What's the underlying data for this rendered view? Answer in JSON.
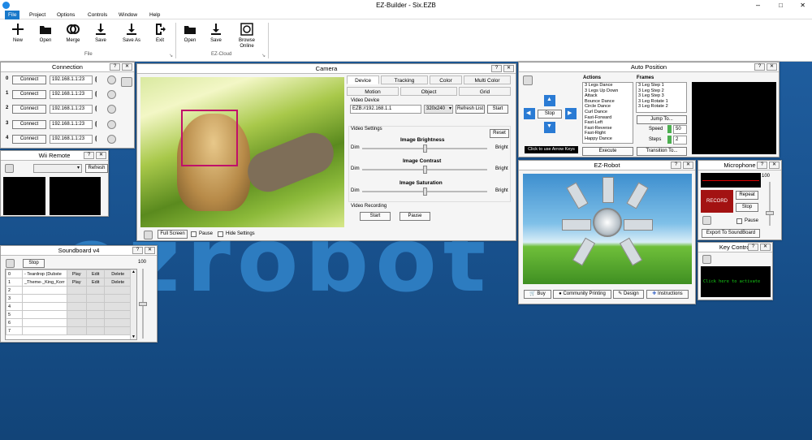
{
  "app": {
    "title": "EZ-Builder - Six.EZB"
  },
  "menu": [
    "File",
    "Project",
    "Options",
    "Controls",
    "Window",
    "Help"
  ],
  "ribbon": {
    "file_buttons": [
      {
        "label": "New",
        "icon": "new-icon"
      },
      {
        "label": "Open",
        "icon": "open-folder-icon"
      },
      {
        "label": "Merge",
        "icon": "merge-icon"
      },
      {
        "label": "Save",
        "icon": "save-icon"
      },
      {
        "label": "Save As",
        "icon": "save-as-icon"
      },
      {
        "label": "Exit",
        "icon": "exit-icon"
      }
    ],
    "file_group": "File",
    "cloud_buttons": [
      {
        "label": "Open",
        "icon": "open-folder-icon"
      },
      {
        "label": "Save",
        "icon": "save-icon"
      },
      {
        "label": "Browse Online",
        "icon": "browse-online-icon"
      }
    ],
    "cloud_group": "EZ-Cloud"
  },
  "background": {
    "logo_text": "ezrobot"
  },
  "connection": {
    "title": "Connection",
    "rows": [
      {
        "index": "0",
        "button": "Connect",
        "address": "192.168.1.1:23"
      },
      {
        "index": "1",
        "button": "Connect",
        "address": "192.168.1.1:23"
      },
      {
        "index": "2",
        "button": "Connect",
        "address": "192.168.1.1:23"
      },
      {
        "index": "3",
        "button": "Connect",
        "address": "192.168.1.1:23"
      },
      {
        "index": "4",
        "button": "Connect",
        "address": "192.168.1.1:23"
      }
    ]
  },
  "wii": {
    "title": "Wii Remote",
    "refresh": "Refresh"
  },
  "soundboard": {
    "title": "Soundboard v4",
    "stop": "Stop",
    "volume": "100",
    "rows": [
      {
        "n": "0",
        "name": "- Teardrop (Dubste",
        "play": "Play",
        "edit": "Edit",
        "delete": "Delete"
      },
      {
        "n": "1",
        "name": "_Theme-_King_Korr",
        "play": "Play",
        "edit": "Edit",
        "delete": "Delete"
      },
      {
        "n": "2",
        "name": "",
        "play": "",
        "edit": "",
        "delete": ""
      },
      {
        "n": "3",
        "name": "",
        "play": "",
        "edit": "",
        "delete": ""
      },
      {
        "n": "4",
        "name": "",
        "play": "",
        "edit": "",
        "delete": ""
      },
      {
        "n": "5",
        "name": "",
        "play": "",
        "edit": "",
        "delete": ""
      },
      {
        "n": "6",
        "name": "",
        "play": "",
        "edit": "",
        "delete": ""
      },
      {
        "n": "7",
        "name": "",
        "play": "",
        "edit": "",
        "delete": ""
      }
    ]
  },
  "camera": {
    "title": "Camera",
    "tabs_row1": [
      "Device",
      "Tracking",
      "Color",
      "Multi Color"
    ],
    "tabs_row2": [
      "Motion",
      "Object",
      "Grid"
    ],
    "video_device_label": "Video Device",
    "device": "EZB://192.168.1.1",
    "resolution": "320x240",
    "refresh_list": "Refresh List",
    "start": "Start",
    "video_settings": "Video Settings",
    "reset": "Reset",
    "brightness": "Image Brightness",
    "contrast": "Image Contrast",
    "saturation": "Image Saturation",
    "dim": "Dim",
    "bright": "Bright",
    "video_recording": "Video Recording",
    "rec_start": "Start",
    "rec_pause": "Pause",
    "full_screen": "Full Screen",
    "pause": "Pause",
    "hide_settings": "Hide Settings"
  },
  "auto_position": {
    "title": "Auto Position",
    "actions_label": "Actions",
    "actions": [
      "3 Legs Dance",
      "3 Legs Up Down",
      "Attack",
      "Bounce Dance",
      "Circle Dance",
      "Curl Dance",
      "Fast-Forward",
      "Fast-Left",
      "Fast-Reverse",
      "Fast-Right",
      "Happy Dance"
    ],
    "frames_label": "Frames",
    "frames": [
      "3 Leg Step 1",
      "3 Leg Step 2",
      "3 Leg Step 3",
      "3 Leg Rotate 1",
      "3 Leg Rotate 2"
    ],
    "stop": "Stop",
    "arrow_hint": "Click to use Arrow Keys",
    "execute": "Execute",
    "jump_to": "Jump To...",
    "speed_label": "Speed",
    "speed": "50",
    "steps_label": "Steps",
    "steps": "2",
    "transition": "Transition To..."
  },
  "ezrobot": {
    "title": "EZ-Robot",
    "buttons": [
      {
        "label": "Buy",
        "icon": "cart-icon"
      },
      {
        "label": "Community Printing",
        "icon": "community-icon"
      },
      {
        "label": "Design",
        "icon": "design-icon"
      },
      {
        "label": "Instructions",
        "icon": "puzzle-icon"
      }
    ]
  },
  "microphone": {
    "title": "Microphone",
    "volume": "100",
    "record": "RECORD",
    "repeat": "Repeat",
    "stop": "Stop",
    "pause": "Pause",
    "export": "Export To SoundBoard"
  },
  "key_control": {
    "title": "Key Control",
    "hint": "Click here to activate"
  }
}
